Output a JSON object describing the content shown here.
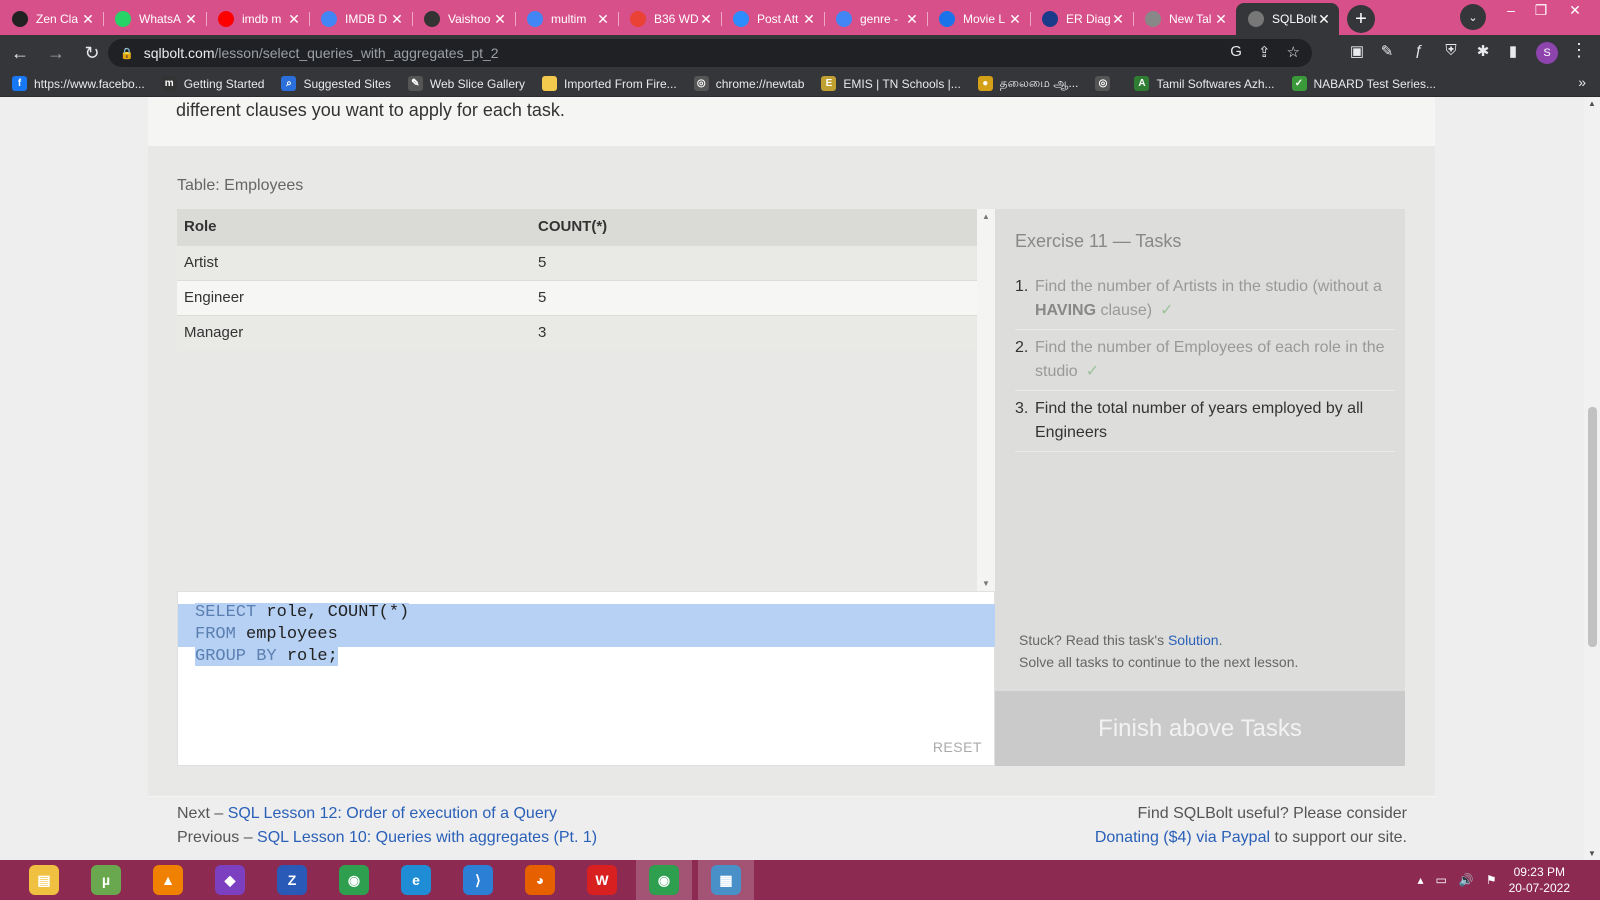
{
  "browser": {
    "tabs": [
      {
        "label": "Zen Cla",
        "icon": "zen-class-favicon",
        "color": "#222222"
      },
      {
        "label": "WhatsA",
        "icon": "whatsapp-favicon",
        "color": "#25d366"
      },
      {
        "label": "imdb m",
        "icon": "youtube-favicon",
        "color": "#ff0000"
      },
      {
        "label": "IMDB D",
        "icon": "google-favicon",
        "color": "#4285f4"
      },
      {
        "label": "Vaishoo",
        "icon": "github-favicon",
        "color": "#333333"
      },
      {
        "label": "multim",
        "icon": "google-favicon",
        "color": "#4285f4"
      },
      {
        "label": "B36 WD",
        "icon": "gmail-favicon",
        "color": "#ea4335"
      },
      {
        "label": "Post Att",
        "icon": "zoom-favicon",
        "color": "#2d8cff"
      },
      {
        "label": "genre -",
        "icon": "google-favicon",
        "color": "#4285f4"
      },
      {
        "label": "Movie L",
        "icon": "movie-favicon",
        "color": "#1a73e8"
      },
      {
        "label": "ER Diag",
        "icon": "star-favicon",
        "color": "#1a3a8a"
      },
      {
        "label": "New Tal",
        "icon": "newtab-favicon",
        "color": "#888888"
      },
      {
        "label": "SQLBolt",
        "icon": "sqlbolt-favicon",
        "color": "#777777",
        "active": true
      }
    ],
    "url_host": "sqlbolt.com",
    "url_path": "/lesson/select_queries_with_aggregates_pt_2",
    "profile_initial": "S",
    "bookmarks": [
      {
        "label": "https://www.facebo...",
        "icon": "facebook-icon",
        "color": "#1877f2",
        "glyph": "f"
      },
      {
        "label": "Getting Started",
        "icon": "m-icon",
        "color": "#333333",
        "glyph": "m"
      },
      {
        "label": "Suggested Sites",
        "icon": "search-icon",
        "color": "#2a6fdb",
        "glyph": "⌕"
      },
      {
        "label": "Web Slice Gallery",
        "icon": "slice-icon",
        "color": "#555555",
        "glyph": "✎"
      },
      {
        "label": "Imported From Fire...",
        "icon": "folder-icon",
        "color": "#f2c94c",
        "glyph": ""
      },
      {
        "label": "chrome://newtab",
        "icon": "globe-icon",
        "color": "#555555",
        "glyph": "◎"
      },
      {
        "label": "EMIS | TN Schools |...",
        "icon": "emis-icon",
        "color": "#c0a030",
        "glyph": "E"
      },
      {
        "label": "தலைமை ஆ...",
        "icon": "emblem-icon",
        "color": "#d4a017",
        "glyph": "●"
      },
      {
        "label": "",
        "icon": "globe-icon",
        "color": "#555555",
        "glyph": "◎"
      },
      {
        "label": "Tamil Softwares Azh...",
        "icon": "tamil-icon",
        "color": "#2e7d32",
        "glyph": "A"
      },
      {
        "label": "NABARD Test Series...",
        "icon": "nabard-icon",
        "color": "#3a9a3a",
        "glyph": "✓"
      }
    ]
  },
  "page": {
    "intro_text": "different clauses you want to apply for each task.",
    "table_caption": "Table: Employees",
    "result": {
      "columns": [
        "Role",
        "COUNT(*)"
      ],
      "rows": [
        [
          "Artist",
          "5"
        ],
        [
          "Engineer",
          "5"
        ],
        [
          "Manager",
          "3"
        ]
      ]
    },
    "editor": {
      "lines": [
        [
          {
            "t": "SELECT",
            "k": true
          },
          {
            "t": " role, COUNT(*)",
            "k": false
          }
        ],
        [
          {
            "t": "FROM",
            "k": true
          },
          {
            "t": " employees",
            "k": false
          }
        ],
        [
          {
            "t": "GROUP BY",
            "k": true
          },
          {
            "t": " role;",
            "k": false
          }
        ]
      ],
      "reset_label": "RESET"
    },
    "tasks": {
      "title": "Exercise 11 — Tasks",
      "items": [
        {
          "num": "1.",
          "before": "Find the number of Artists in the studio (without a ",
          "strong": "HAVING",
          "after": " clause)",
          "done": true
        },
        {
          "num": "2.",
          "before": "Find the number of Employees of each role in the studio",
          "strong": "",
          "after": "",
          "done": true
        },
        {
          "num": "3.",
          "before": "Find the total number of years employed by all Engineers",
          "strong": "",
          "after": "",
          "done": false
        }
      ],
      "check_glyph": "✓",
      "help_prefix": "Stuck? Read this task's ",
      "help_link": "Solution",
      "help_suffix": ".",
      "help_line2": "Solve all tasks to continue to the next lesson.",
      "finish_label": "Finish above Tasks"
    },
    "footer": {
      "next_prefix": "Next – ",
      "next_link": "SQL Lesson 12: Order of execution of a Query",
      "prev_prefix": "Previous – ",
      "prev_link": "SQL Lesson 10: Queries with aggregates (Pt. 1)",
      "right_line1": "Find SQLBolt useful? Please consider",
      "donate_link": "Donating ($4) via Paypal",
      "right_suffix": " to support our site."
    }
  },
  "taskbar": {
    "apps": [
      {
        "icon": "file-explorer-icon",
        "color": "#f0c040",
        "glyph": "▤"
      },
      {
        "icon": "utorrent-icon",
        "color": "#6aa84f",
        "glyph": "µ"
      },
      {
        "icon": "vlc-icon",
        "color": "#f08000",
        "glyph": "▲"
      },
      {
        "icon": "visual-studio-icon",
        "color": "#7b3fbf",
        "glyph": "◆"
      },
      {
        "icon": "azure-data-studio-icon",
        "color": "#2a5ab8",
        "glyph": "Z"
      },
      {
        "icon": "chrome-icon",
        "color": "#2e9e4f",
        "glyph": "◉"
      },
      {
        "icon": "edge-icon",
        "color": "#1f8dd6",
        "glyph": "e"
      },
      {
        "icon": "vscode-icon",
        "color": "#2b7fd4",
        "glyph": "⟩"
      },
      {
        "icon": "firefox-icon",
        "color": "#e66000",
        "glyph": "◕"
      },
      {
        "icon": "wps-office-icon",
        "color": "#d92020",
        "glyph": "W"
      },
      {
        "icon": "chrome-profile-icon",
        "color": "#2e9e4f",
        "glyph": "◉",
        "active": true
      },
      {
        "icon": "photos-icon",
        "color": "#4a90c8",
        "glyph": "▦",
        "active": true
      }
    ],
    "time": "09:23 PM",
    "date": "20-07-2022"
  }
}
